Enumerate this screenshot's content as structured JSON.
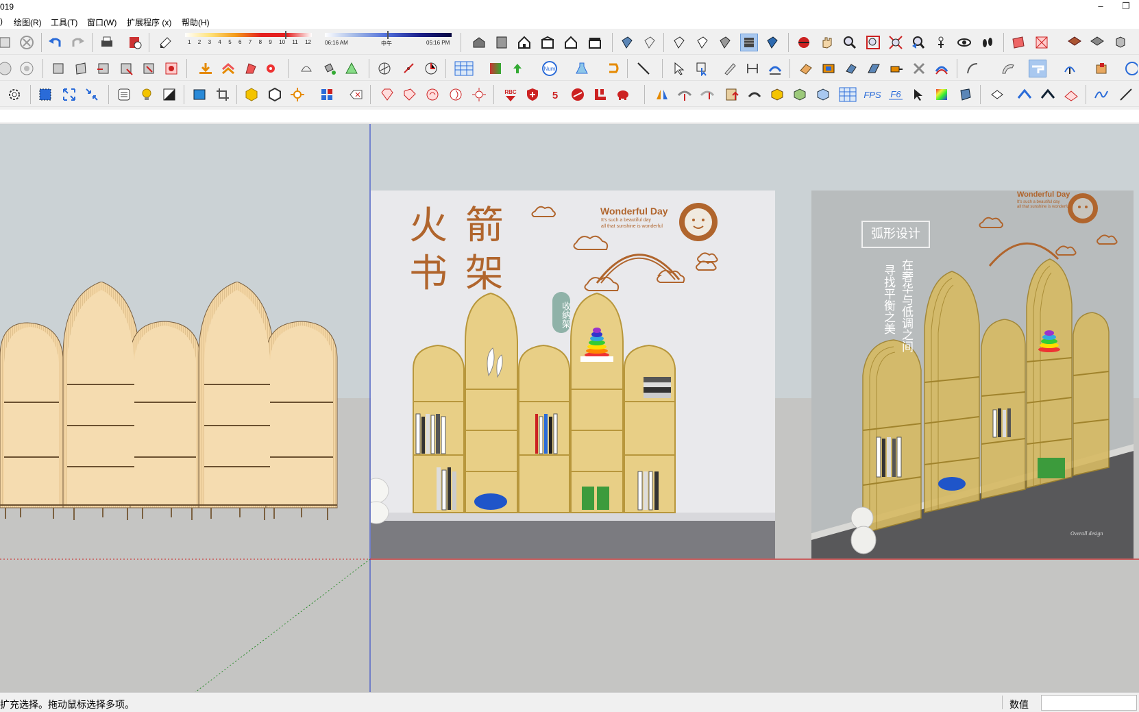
{
  "window": {
    "title": "019",
    "controls": [
      "–",
      "❐"
    ]
  },
  "menu": [
    {
      "label": ")"
    },
    {
      "label": "绘图(R)"
    },
    {
      "label": "工具(T)"
    },
    {
      "label": "窗口(W)"
    },
    {
      "label": "扩展程序 (x)"
    },
    {
      "label": "帮助(H)"
    }
  ],
  "shadow_bar": {
    "scale_numbers": [
      "1",
      "2",
      "3",
      "4",
      "5",
      "6",
      "7",
      "8",
      "9",
      "10",
      "11",
      "12"
    ],
    "time_start": "06:16 AM",
    "time_mid": "中午",
    "time_end": "05:16 PM"
  },
  "toolbar": {
    "num_button_label": "Num",
    "rbc_label": "RBC",
    "fps_label": "FPS",
    "f6_label": "F6"
  },
  "viewport": {
    "poster1": {
      "title_line1": "火 箭",
      "title_line2": "书 架",
      "badge": "收纳架",
      "brand_title": "Wonderful Day",
      "brand_line1": "It's such a beautiful day",
      "brand_line2": "all that sunshine is wonderful"
    },
    "poster2": {
      "label": "弧形设计",
      "vertical_text1": "寻找平衡之美",
      "vertical_text2": "在奢华与低调之间",
      "brand_title": "Wonderful Day",
      "brand_line1": "It's such a beautiful day",
      "brand_line2": "all that sunshine is wonderful",
      "watermark": "Overall design"
    }
  },
  "status": {
    "message": "扩充选择。拖动鼠标选择多项。",
    "value_label": "数值",
    "value": ""
  },
  "colors": {
    "accent": "#2a6bd8",
    "model_fill": "#f3d5a3",
    "gold": "#d7ba63",
    "poster_brown": "#b0652d"
  }
}
